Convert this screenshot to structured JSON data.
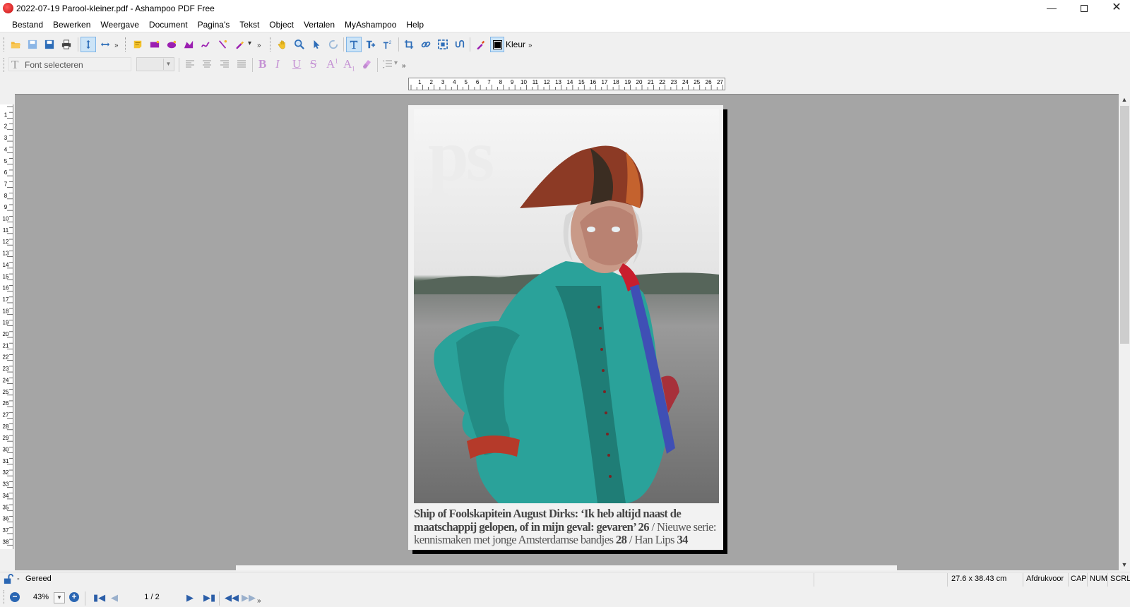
{
  "window": {
    "title": "2022-07-19 Parool-kleiner.pdf - Ashampoo PDF Free"
  },
  "menu": [
    "Bestand",
    "Bewerken",
    "Weergave",
    "Document",
    "Pagina's",
    "Tekst",
    "Object",
    "Vertalen",
    "MyAshampoo",
    "Help"
  ],
  "toolbar": {
    "color_label": "Kleur",
    "overflow": "»"
  },
  "format_bar": {
    "font_placeholder": "Font selecteren",
    "font_size": ""
  },
  "ruler": {
    "horizontal": [
      "1",
      "2",
      "3",
      "4",
      "5",
      "6",
      "7",
      "8",
      "9",
      "10",
      "11",
      "12",
      "13",
      "14",
      "15",
      "16",
      "17",
      "18",
      "19",
      "20",
      "21",
      "22",
      "23",
      "24",
      "25",
      "26",
      "27"
    ],
    "vertical": [
      "1",
      "2",
      "3",
      "4",
      "5",
      "6",
      "7",
      "8",
      "9",
      "10",
      "11",
      "12",
      "13",
      "14",
      "15",
      "16",
      "17",
      "18",
      "19",
      "20",
      "21",
      "22",
      "23",
      "24",
      "25",
      "26",
      "27",
      "28",
      "29",
      "30",
      "31",
      "32",
      "33",
      "34",
      "35",
      "36",
      "37",
      "38"
    ]
  },
  "document": {
    "masthead": "ps",
    "headline_bold": "Ship of Foolskapitein August Dirks: ‘Ik heb altijd naast de maatschappij gelopen, of in mijn geval: gevaren’ 26",
    "headline_rest1": " / Nieuwe serie: kennismaken met jonge Amsterdamse bandjes ",
    "headline_num2": "28",
    "headline_rest2": " / Han Lips ",
    "headline_num3": "34"
  },
  "status": {
    "state": "Gereed",
    "dimensions": "27.6 x 38.43 cm",
    "print": "Afdrukvoor",
    "cap": "CAP",
    "num": "NUM",
    "scrl": "SCRL"
  },
  "navigation": {
    "zoom": "43%",
    "page_indicator": "1 / 2"
  },
  "colors": {
    "accent": "#2a66b3",
    "workspace": "#a5a5a5",
    "active_tool": "#cce4f7"
  }
}
